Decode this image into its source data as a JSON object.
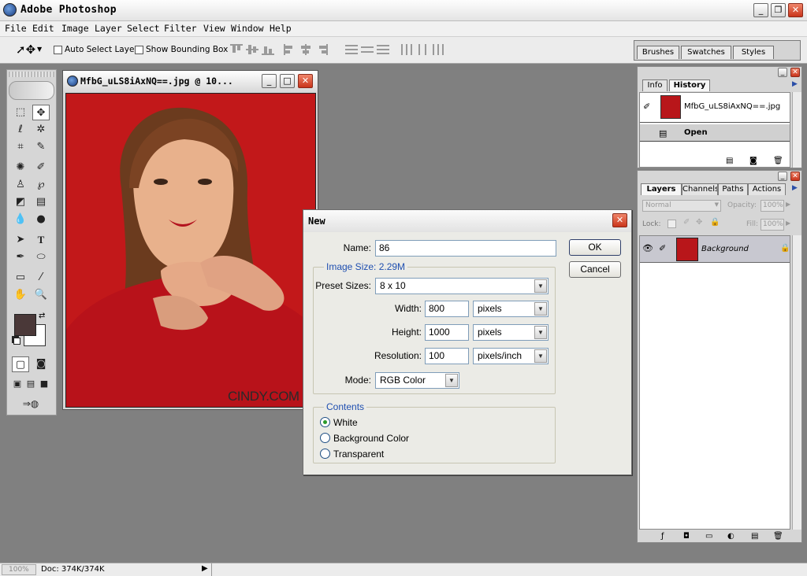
{
  "app": {
    "title": "Adobe Photoshop"
  },
  "menu": [
    "File",
    "Edit",
    "Image",
    "Layer",
    "Select",
    "Filter",
    "View",
    "Window",
    "Help"
  ],
  "options": {
    "auto_select_label": "Auto Select Layer",
    "bounding_box_label": "Show Bounding Box"
  },
  "palette_well": {
    "tabs": [
      "Brushes",
      "Swatches",
      "Styles"
    ]
  },
  "document": {
    "title": "MfbG_uLS8iAxNQ==.jpg @ 10...",
    "watermark": "CINDY.COM"
  },
  "history": {
    "tabs": [
      "Info",
      "History"
    ],
    "snapshot_name": "MfbG_uLS8iAxNQ==.jpg",
    "state": "Open"
  },
  "layers": {
    "tabs": [
      "Layers",
      "Channels",
      "Paths",
      "Actions"
    ],
    "blend_mode": "Normal",
    "opacity_label": "Opacity:",
    "opacity_value": "100%",
    "lock_label": "Lock:",
    "fill_label": "Fill:",
    "fill_value": "100%",
    "layer_name": "Background"
  },
  "dialog": {
    "title": "New",
    "name_label": "Name:",
    "name_value": "86",
    "ok": "OK",
    "cancel": "Cancel",
    "image_size": "Image Size: 2.29M",
    "preset_label": "Preset Sizes:",
    "preset_value": "8 x 10",
    "width_label": "Width:",
    "width_value": "800",
    "width_unit": "pixels",
    "height_label": "Height:",
    "height_value": "1000",
    "height_unit": "pixels",
    "resolution_label": "Resolution:",
    "resolution_value": "100",
    "resolution_unit": "pixels/inch",
    "mode_label": "Mode:",
    "mode_value": "RGB Color",
    "contents_label": "Contents",
    "contents_options": [
      "White",
      "Background Color",
      "Transparent"
    ],
    "contents_selected": "White"
  },
  "status": {
    "zoom": "100%",
    "doc": "Doc: 374K/374K"
  }
}
